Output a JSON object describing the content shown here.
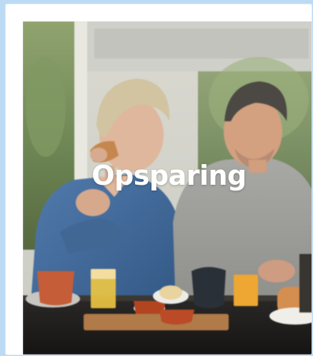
{
  "card": {
    "title": "Opsparing"
  },
  "colors": {
    "page_background": "#bcdaf3",
    "card_frame": "#ffffff",
    "title_text": "#ffffff"
  }
}
